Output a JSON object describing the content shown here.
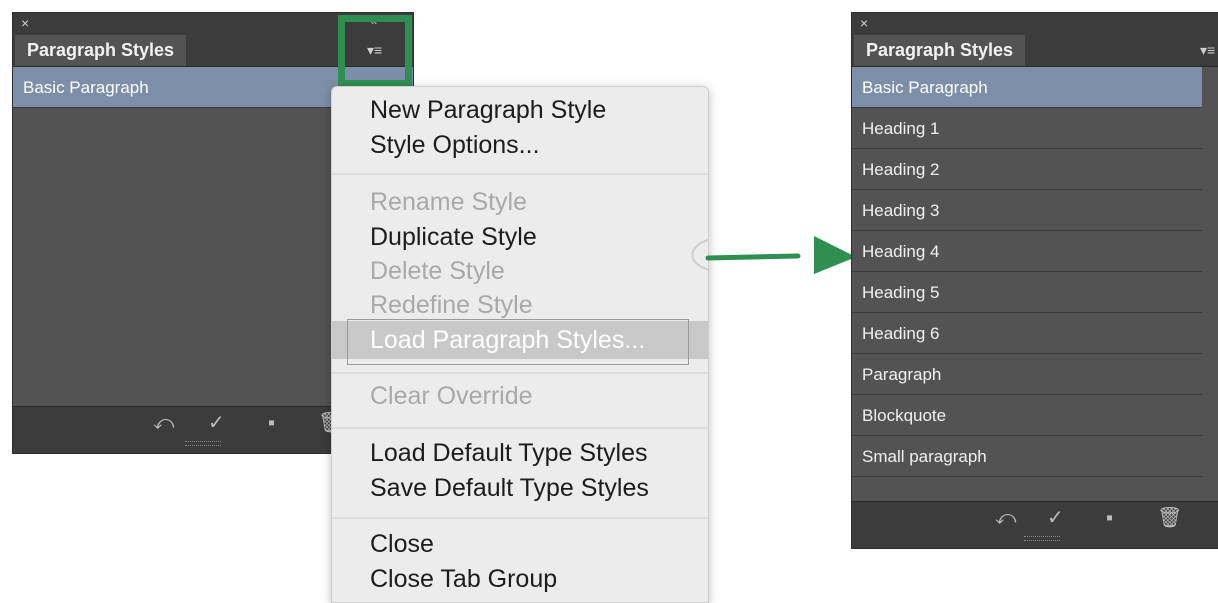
{
  "left_panel": {
    "close": "×",
    "collapse": "«",
    "tab_title": "Paragraph Styles",
    "menu_icon": "▾≡",
    "styles": [
      "Basic Paragraph"
    ]
  },
  "menu": {
    "items": [
      {
        "label": "New Paragraph Style",
        "enabled": true
      },
      {
        "label": "Style Options...",
        "enabled": true
      },
      {
        "label": "Rename Style",
        "enabled": false
      },
      {
        "label": "Duplicate Style",
        "enabled": true
      },
      {
        "label": "Delete Style",
        "enabled": false
      },
      {
        "label": "Redefine Style",
        "enabled": false
      },
      {
        "label": "Load Paragraph Styles...",
        "enabled": true,
        "highlighted": true
      },
      {
        "label": "Clear Override",
        "enabled": false
      },
      {
        "label": "Load Default Type Styles",
        "enabled": true
      },
      {
        "label": "Save Default Type Styles",
        "enabled": true
      },
      {
        "label": "Close",
        "enabled": true
      },
      {
        "label": "Close Tab Group",
        "enabled": true
      }
    ]
  },
  "right_panel": {
    "close": "×",
    "tab_title": "Paragraph Styles",
    "menu_icon": "▾≡",
    "styles": [
      "Basic Paragraph",
      "Heading 1",
      "Heading 2",
      "Heading 3",
      "Heading 4",
      "Heading 5",
      "Heading 6",
      "Paragraph",
      "Blockquote",
      "Small paragraph"
    ]
  },
  "footer_icons": [
    "clear-override-icon",
    "redefine-check-icon",
    "new-style-icon",
    "trash-icon"
  ],
  "colors": {
    "accent_green": "#2f8f53",
    "selection": "#7d8fa8",
    "panel": "#535353"
  }
}
